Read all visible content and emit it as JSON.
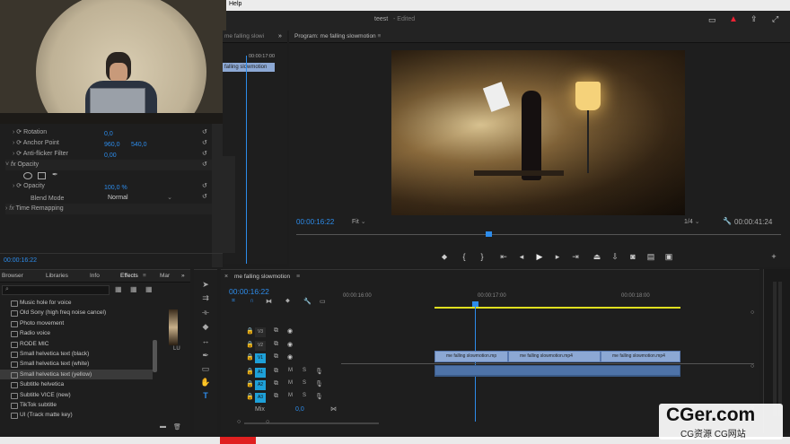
{
  "menu": {
    "help": "Help"
  },
  "title": {
    "project": "teest",
    "status": "- Edited"
  },
  "source_monitor": {
    "clip_label": "me falling slowi",
    "timecode": "00:00:17:00",
    "clip_name": "falling slowmotion"
  },
  "effect_controls": {
    "rotation": {
      "label": "Rotation",
      "value": "0,0"
    },
    "anchor_point": {
      "label": "Anchor Point",
      "x": "960,0",
      "y": "540,0"
    },
    "anti_flicker": {
      "label": "Anti-flicker Filter",
      "value": "0,00"
    },
    "opacity_section": "Opacity",
    "opacity": {
      "label": "Opacity",
      "value": "100,0 %"
    },
    "blend_mode": {
      "label": "Blend Mode",
      "value": "Normal"
    },
    "time_remapping": "Time Remapping",
    "timecode": "00:00:16:22"
  },
  "program": {
    "title": "Program: me falling slowmotion",
    "timecode": "00:00:16:22",
    "fit": "Fit",
    "ratio": "1/4",
    "duration": "00:00:41:24"
  },
  "effects_panel": {
    "tabs": [
      "Browser",
      "Libraries",
      "Info",
      "Effects",
      "Mar"
    ],
    "items": [
      "Music hole for voice",
      "Old Sony (high freq noise cancel)",
      "Photo movement",
      "Radio voice",
      "RODE MIC",
      "Small helvetica text (black)",
      "Small helvetica text (white)",
      "Small helvetica text (yellow)",
      "Subtitle helvetica",
      "Subtitle VICE (new)",
      "TikTok subtitle",
      "UI (Track matte key)"
    ],
    "lu_label": "LU"
  },
  "timeline": {
    "title": "me falling slowmotion",
    "timecode": "00:00:16:22",
    "ruler": [
      "00:00:16:00",
      "00:00:17:00",
      "00:00:18:00"
    ],
    "video_tracks": [
      "V3",
      "V2",
      "V1"
    ],
    "audio_tracks": [
      "A1",
      "A2",
      "A3"
    ],
    "clips": [
      "me falling slowmotion.mp",
      "me falling slowmotion.mp4",
      "me falling slowmotion.mp4"
    ],
    "mix_label": "Mix",
    "mix_value": "0,0"
  },
  "watermark": {
    "brand": "CGer.com",
    "subtitle": "CG资源 CG网站"
  },
  "colors": {
    "accent": "#2d8ceb",
    "track_active": "#1ea0d8",
    "clip": "#8ca8d4"
  }
}
